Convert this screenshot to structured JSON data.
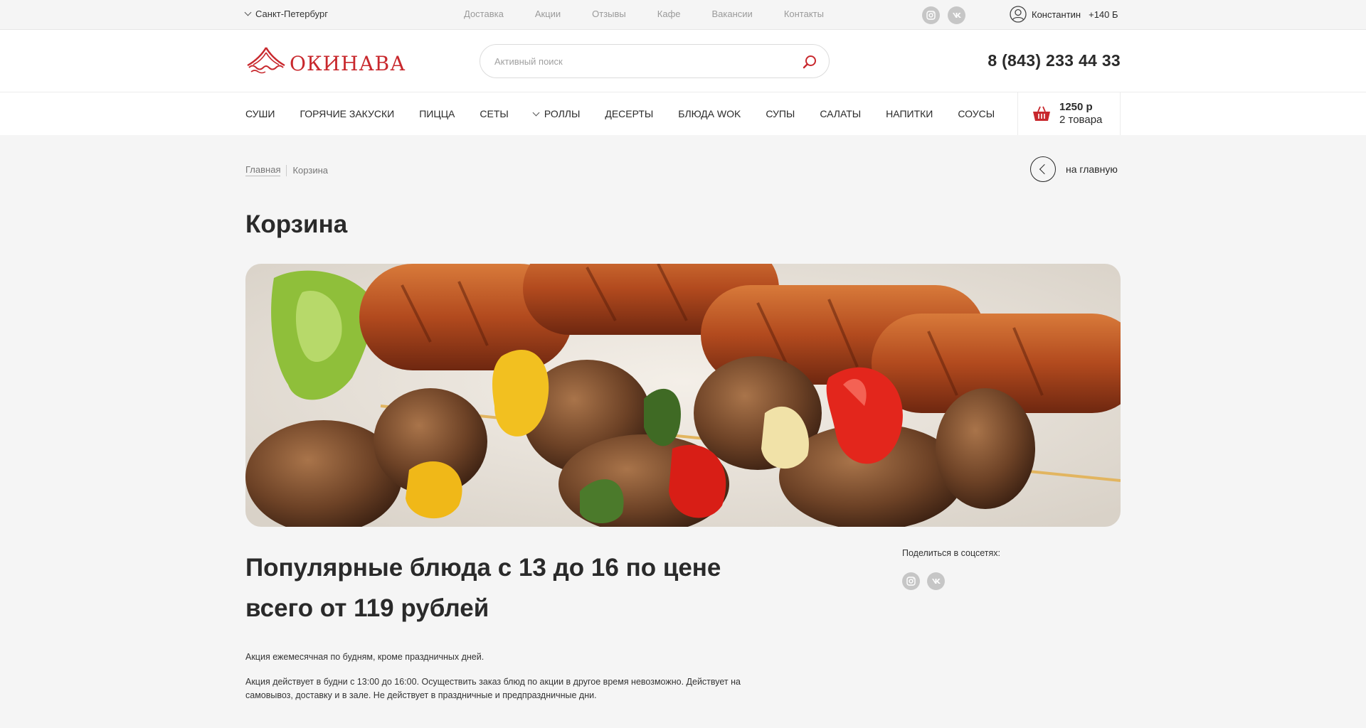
{
  "topbar": {
    "city": "Санкт-Петербург",
    "links": [
      "Доставка",
      "Акции",
      "Отзывы",
      "Кафе",
      "Вакансии",
      "Контакты"
    ],
    "user_name": "Константин",
    "user_points": "+140 Б"
  },
  "header": {
    "logo_text": "ОКИНАВА",
    "search_placeholder": "Активный поиск",
    "phone": "8 (843) 233 44 33"
  },
  "nav": {
    "items": [
      "Суши",
      "Горячие закуски",
      "Пицца",
      "Сеты",
      "Роллы",
      "Десерты",
      "Блюда WOK",
      "Супы",
      "Салаты",
      "Напитки",
      "Соусы"
    ],
    "cart_sum": "1250 р",
    "cart_count": "2 товара"
  },
  "breadcrumb": {
    "home": "Главная",
    "current": "Корзина",
    "back_label": "на главную"
  },
  "page": {
    "title": "Корзина",
    "promo_title": "Популярные блюда с 13 до 16 по цене всего от 119 рублей",
    "paragraph_1": "Акция ежемесячная по будням, кроме праздничных дней.",
    "paragraph_2": "Акция действует в будни с 13:00 до 16:00. Осуществить заказ блюд по акции в другое время невозможно. Действует на самовывоз, доставку и в зале. Не действует в праздничные и предпраздничные дни.",
    "share_label": "Поделиться в соцсетях:"
  },
  "colors": {
    "accent": "#c8282d",
    "background": "#f5f5f5",
    "text": "#2a2a2a",
    "social_gray": "#c6c6c6"
  },
  "icons": {
    "instagram": "instagram-icon",
    "vk": "vk-icon",
    "user": "user-icon",
    "search": "search-icon",
    "basket": "basket-icon"
  }
}
